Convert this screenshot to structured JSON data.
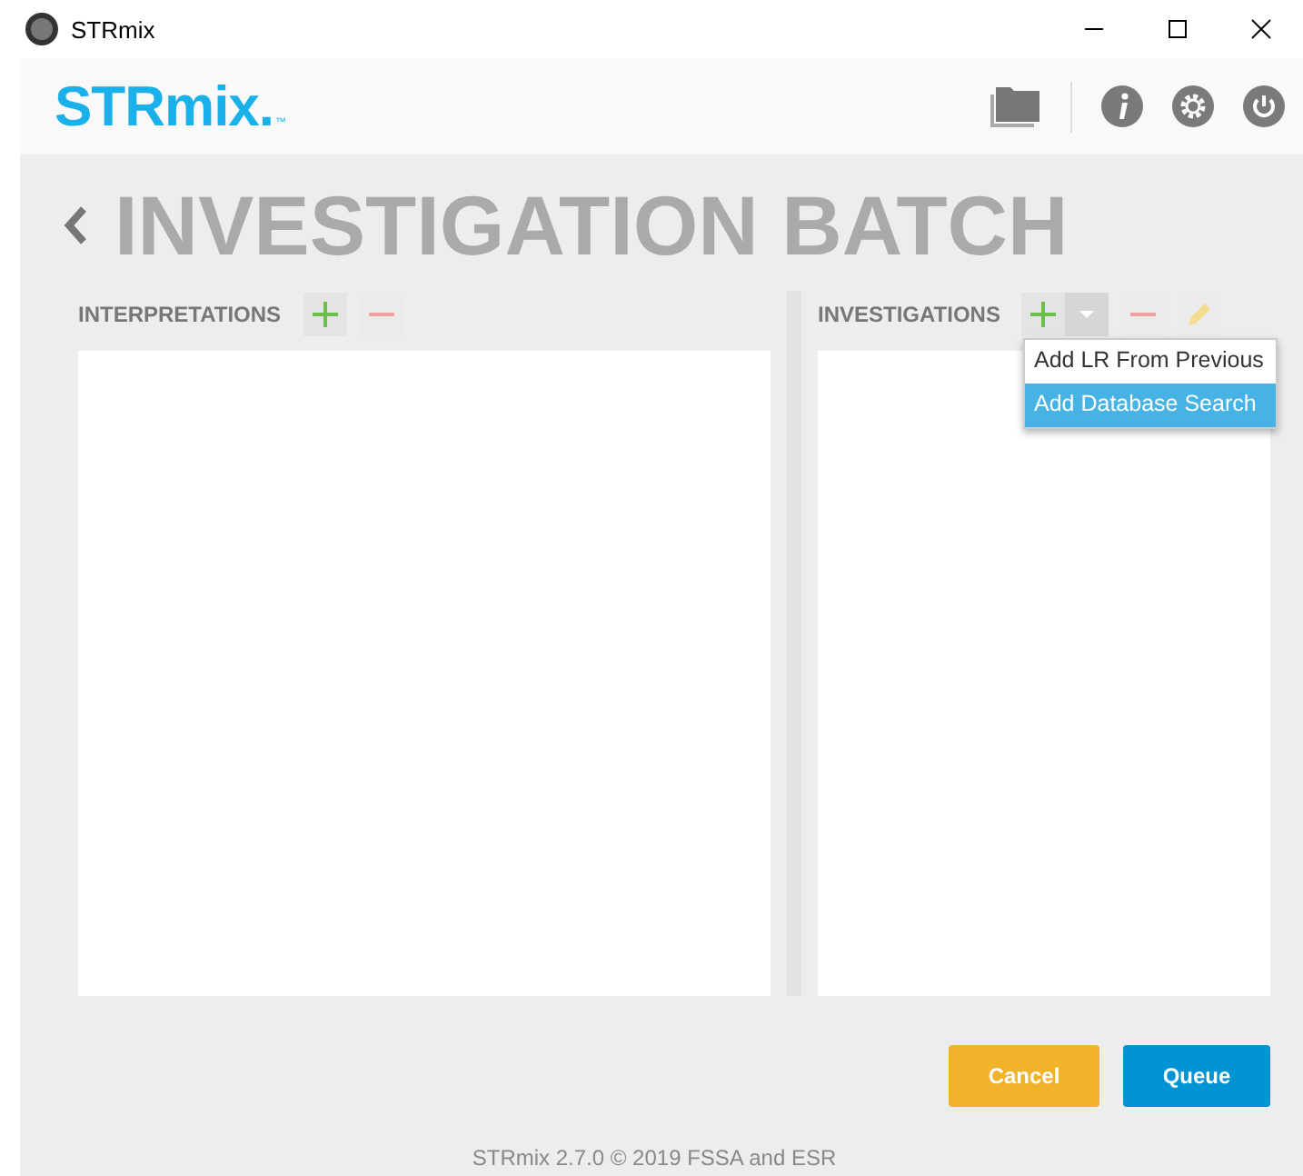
{
  "window": {
    "title": "STRmix"
  },
  "header": {
    "logo": "STRmix.",
    "logo_mark": "™"
  },
  "heading": "INVESTIGATION BATCH",
  "panels": [
    {
      "label": "INTERPRETATIONS",
      "buttons": [
        {
          "kind": "add",
          "disabled": false
        },
        {
          "kind": "remove",
          "disabled": true
        }
      ]
    },
    {
      "label": "INVESTIGATIONS",
      "buttons": [
        {
          "kind": "add",
          "disabled": false
        },
        {
          "kind": "dropdown",
          "expanded": true
        },
        {
          "kind": "remove",
          "disabled": true
        },
        {
          "kind": "edit",
          "disabled": true
        }
      ],
      "menu": [
        {
          "label": "Add LR From Previous",
          "selected": false
        },
        {
          "label": "Add Database Search",
          "selected": true
        }
      ]
    }
  ],
  "actions": [
    {
      "label": "Cancel",
      "kind": "cancel"
    },
    {
      "label": "Queue",
      "kind": "primary"
    }
  ],
  "footer": "STRmix 2.7.0 © 2019 FSSA and ESR"
}
